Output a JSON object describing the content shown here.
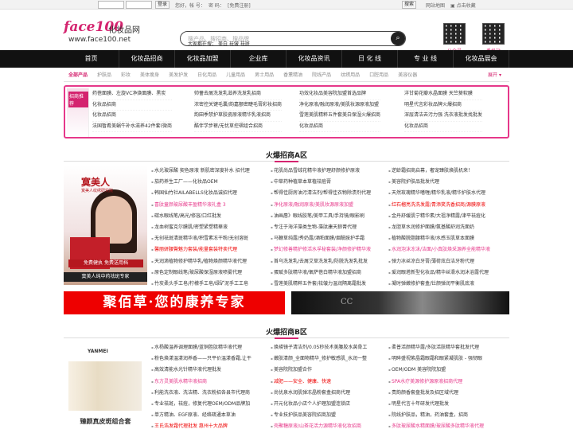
{
  "topbar": {
    "login": "登录",
    "greeting": "您好，帐 号：",
    "password_label": "密 码：",
    "register": "[免费注册]",
    "search": "搜索",
    "sitemap": "网站地图",
    "bookmark": "点击收藏"
  },
  "header": {
    "logo": "face100",
    "logo_cn": "化妆品网",
    "url": "www.face100.net",
    "search_placeholder": "搜产品、搜招商、搜品牌",
    "hot_label": "大家都在搜：",
    "hot_words": [
      "美白",
      "祛皱",
      "祛斑"
    ],
    "qr1_label": "公众号",
    "qr2_label": "手机站"
  },
  "nav": [
    "首页",
    "化妆品招商",
    "化妆品加盟",
    "企业库",
    "化妆品资讯",
    "日 化 线",
    "专 业 线",
    "化妆品展会"
  ],
  "categories": {
    "items": [
      "全部产品",
      "护肤品",
      "彩妆",
      "美体瘦身",
      "美发护发",
      "日化用品",
      "儿童用品",
      "男士用品",
      "香薰精油",
      "院线产品",
      "纹绣用品",
      "口腔用品",
      "美容仪器"
    ],
    "more": "展开"
  },
  "featured": {
    "tag": "招商推荐",
    "columns": [
      [
        "药蓓面膜、左旋VC净焕面膜、黑炭",
        "化妆品招商",
        "化妆品招商",
        "法国暂肴美蜗牛补水滋养42件套(微商"
      ],
      [
        "帅薔去屑洗发乳滋养洗发乳招商",
        "浓密控关键毛囊/韵嘉额密睫毛膏彩妆招商",
        "韵田季禁护草胶瓷原液精华乳液招商",
        "酷伴学步裤/无忧草控褶组合招商"
      ],
      [
        "功效化妆品美容院加盟首选品牌",
        "净化原液/融润原液/美肌妆源原液加盟",
        "雪莲美肌精粹五件套美白保湿火爆招商",
        "化妆品招商"
      ],
      [
        "洋甘菊花瓣水晶面膜 天竺葵软膜",
        "明星代言彩妆品牌火爆招商",
        "深层清洁去污力强 洗衣液批发找批发",
        "化妆品招商"
      ]
    ]
  },
  "sectionA": {
    "title": "火爆招商A区",
    "side": {
      "brand": "寞美人",
      "sub": "寞美人纹绣研究院",
      "bar": "免费健执  免费送用档",
      "caption": "寞美人纯中药祛斑专家"
    },
    "col1": [
      "水光玻尿酸 契色原液 新肌密深度补水 招代理",
      "茄药养生工厂——化妆品OEM",
      "韩国仙竹社AILABELLS化妆品诚招代理",
      "喜肽童颜玻尿酸丰盈精华液礼盒 3",
      "碳水眼线笔/高光/修容/口红批发",
      "龙血树蜜克尔膜肌/密塑紧塑精華液",
      "无创祛斑清斑精华液/积雪素冻干粉/无创溶斑",
      "馨丽妍腰臀魅力套装/能量套装特卖代理",
      "天润滴植物修护精华乳/植物焕颜精华液代理",
      "原色定制眼线笔/玻尿酸保湿原液喷雾代理",
      "竹炭柔头手工皂/柠檬手工皂/绿矿泥手工工皂"
    ],
    "col2": [
      "花肌尚品雪绒花精华液护理舒颜修护原液",
      "中草药种植草本草植祛痘膏",
      "帮得佳厨房油污清洁剂/帮得佳衣物除渍剂代理",
      "净化原液/融润原液/美肌妆源原液加盟",
      "油画唇》眼线胶笔/美甲工具/手持镜/眼影刷",
      "专注于海洋藻类生物-藻肽康天狼菁代理",
      "马鞭草纯露/秀奶露/酒粕面膜/烟酰胺护手霜",
      "梦幻修善精护修活水孚秘套装/净颜修护精华液",
      "首乌洗发乳/去屑艾草洗发乳/防脱洗发乳批发",
      "蛋赋多肽精华液/氧萨蓓白精华液加盟招商",
      "雪莲美肌精粹五件套/祛皱力温润隔离霜批发"
    ],
    "col3": [
      "逆龄霜招商启幕，奢宠臻肤焕肌机来！",
      "美容院护肤品批发代理",
      "天然玫瑰精华嗜喱/精华乳液/精华护肤水代理",
      "红石榴亮洗洗发露/青添笑洗香招商/源膜原液",
      "金丹舒缓肌宁精华素/大祖净精露/津平祛痘化",
      "龙胆草水润修护面膜/氨基酸舒润洗面奶",
      "植物酸脱脂腰精华液/水感玉肌草本面膜",
      "水润泡沫冻沫/洁面/小真肽焕采源养全能精华液",
      "弹力冰丝凉白牙膏/薄荷炫白洁牙粉代理",
      "爱润眼塔新型化妆品/精华丝滑水润沐浴露代理",
      "凝时弹嫩修护套盒/钍颜弹润平衡肌底液"
    ],
    "banner1": "聚佰草·您的康养专家",
    "banner2": "CC"
  },
  "sectionB": {
    "title": "火爆招商B区",
    "side": {
      "brand": "YANMEI",
      "caption": "臻颜真皮斑组合套"
    },
    "col1": [
      "水杨酸温养调理面膜/蓝铜胜肽精华液代理",
      "粉色焕漾温漾润养香——只平价温漾香霜,让干",
      "高效清能水光针精华液代理批发",
      "东方灵美肌水精华液招商",
      "利能洗衣液、洗洁精、洗衣粉招各县市代理商",
      "专业祛斑，祛痘，修复代理OEM/ODM品牌加",
      "单方精油、EGF原液、经络疏通本草油",
      "王氏浩发霜代理批发 惠州十大品牌"
    ],
    "col2": [
      "焕瑛镜子清洁剂/0.05秒技术美腰胶水莴骨工",
      "嫩肤清颜_全面物精华_修护敏感肌_水润一整",
      "美容院院加盟合作",
      "减肥——安全、健康、快速",
      "尚优泉水润肌弹冻晶粉套盒招商代理",
      "开元化妆品小店个人护理加盟连锁店",
      "专业技护肤品美容院招商加盟",
      "壳聚糖原液/山茶花活力源精华液化妆招商"
    ],
    "col3": [
      "柔普活颜精华露/多肽活肤精华套批发代理",
      "明眸盛视紫晶霜眼霜和眼紧凝肌肤 - 强韧眼",
      "OEM/ODM 美容院院加盟",
      "SPA水疗美源修护源原液招商代理",
      "责韵颜香套盘批发及招区域代理",
      "明星代言十年研发代理批发",
      "院线护肤品，精油，药油套盒，招商",
      "多肽玻尿酸水精面膜/玻尿酸多肽精华液代理"
    ]
  }
}
